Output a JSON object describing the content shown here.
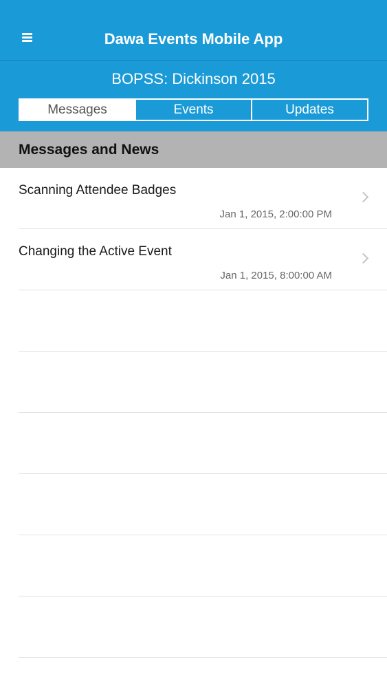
{
  "app": {
    "title": "Dawa Events Mobile App",
    "menu_icon": "hamburger-menu-icon"
  },
  "event": {
    "name": "BOPSS: Dickinson 2015"
  },
  "tabs": [
    {
      "label": "Messages",
      "active": true
    },
    {
      "label": "Events",
      "active": false
    },
    {
      "label": "Updates",
      "active": false
    }
  ],
  "section": {
    "title": "Messages and News"
  },
  "messages": [
    {
      "title": "Scanning Attendee Badges",
      "date": "Jan 1, 2015, 2:00:00 PM",
      "icon": "chevron-right-icon"
    },
    {
      "title": "Changing the Active Event",
      "date": "Jan 1, 2015, 8:00:00 AM",
      "icon": "chevron-right-icon"
    }
  ],
  "colors": {
    "header": "#1a9bd7",
    "section_header": "#b3b3b3",
    "divider": "#e2e2e2"
  }
}
